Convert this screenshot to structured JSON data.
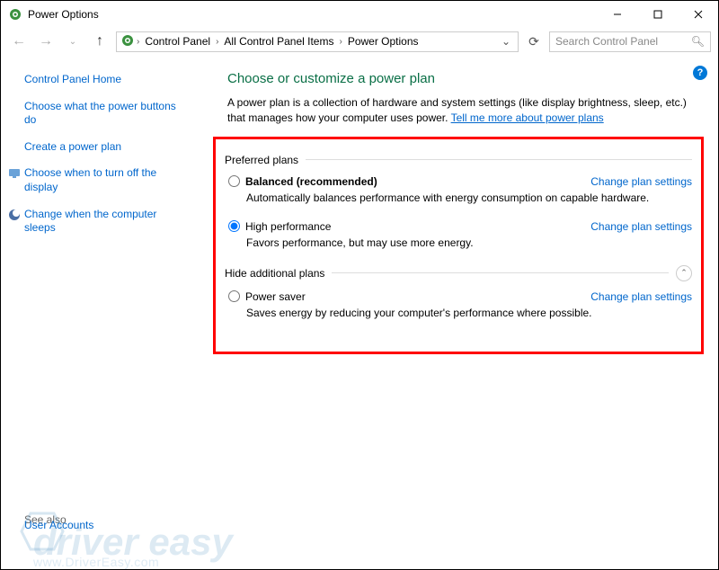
{
  "titlebar": {
    "title": "Power Options"
  },
  "breadcrumb": {
    "items": [
      "Control Panel",
      "All Control Panel Items",
      "Power Options"
    ]
  },
  "search": {
    "placeholder": "Search Control Panel"
  },
  "sidebar": {
    "home": "Control Panel Home",
    "links": [
      "Choose what the power buttons do",
      "Create a power plan",
      "Choose when to turn off the display",
      "Change when the computer sleeps"
    ],
    "see_also_label": "See also",
    "see_also_link": "User Accounts"
  },
  "main": {
    "heading": "Choose or customize a power plan",
    "intro_text": "A power plan is a collection of hardware and system settings (like display brightness, sleep, etc.) that manages how your computer uses power. ",
    "intro_link": "Tell me more about power plans",
    "group1": "Preferred plans",
    "group2": "Hide additional plans",
    "change_link": "Change plan settings",
    "plans": [
      {
        "name": "Balanced (recommended)",
        "desc": "Automatically balances performance with energy consumption on capable hardware.",
        "bold": true,
        "selected": false
      },
      {
        "name": "High performance",
        "desc": "Favors performance, but may use more energy.",
        "bold": false,
        "selected": true
      }
    ],
    "plans2": [
      {
        "name": "Power saver",
        "desc": "Saves energy by reducing your computer's performance where possible.",
        "bold": false,
        "selected": false
      }
    ]
  },
  "watermark": {
    "text": "driver easy",
    "sub": "www.DriverEasy.com"
  }
}
